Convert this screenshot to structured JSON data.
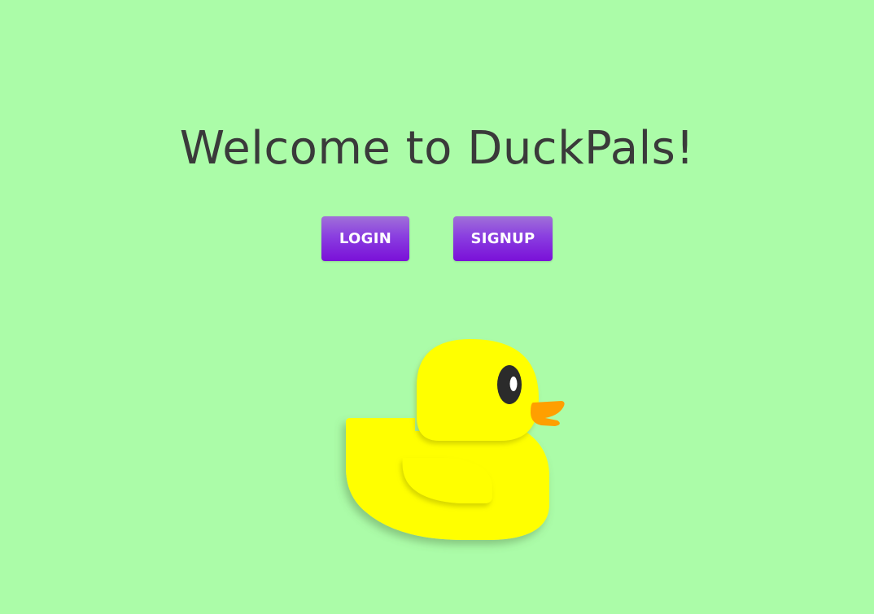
{
  "header": {
    "title": "Welcome to DuckPals!"
  },
  "actions": {
    "login_label": "LOGIN",
    "signup_label": "SIGNUP"
  },
  "colors": {
    "background": "#abfca8",
    "title": "#3a3a3a",
    "button": "#8a2be2",
    "duck_body": "#ffff00",
    "duck_beak": "#ff9f00",
    "duck_eye": "#2b2b2b"
  },
  "illustration": {
    "icon": "rubber-duck-icon"
  }
}
